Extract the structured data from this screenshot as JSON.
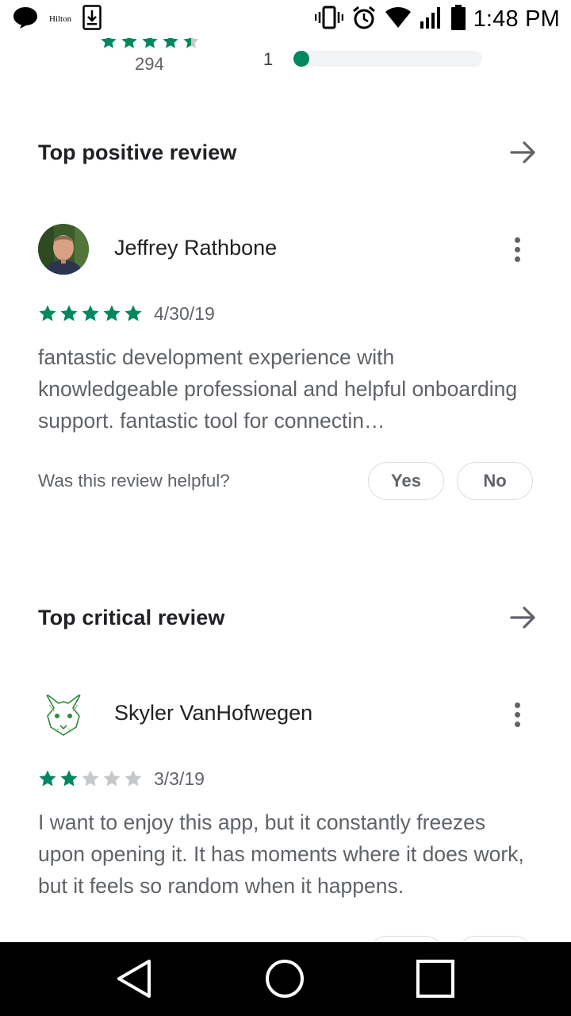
{
  "status_bar": {
    "notification_app_label": "Hilton",
    "time": "1:48 PM",
    "icons": [
      "chat-bubble-icon",
      "download-icon",
      "vibrate-icon",
      "alarm-icon",
      "wifi-icon",
      "signal-icon",
      "battery-icon"
    ]
  },
  "rating_summary": {
    "average_stars": 4.5,
    "review_count": "294",
    "histogram_row_label": "1",
    "histogram_row_fraction": 0.05
  },
  "top_positive": {
    "title": "Top positive review",
    "author": "Jeffrey Rathbone",
    "stars": 5,
    "date": "4/30/19",
    "text": "fantastic development experience with knowledgeable professional and helpful onboarding support. fantastic tool for connectin…",
    "helpful_question": "Was this review helpful?",
    "yes_label": "Yes",
    "no_label": "No"
  },
  "top_critical": {
    "title": "Top critical review",
    "author": "Skyler VanHofwegen",
    "stars": 2,
    "date": "3/3/19",
    "text": "I want to enjoy this app, but it constantly freezes upon opening it. It has moments where it does work, but it feels so random when it happens."
  },
  "colors": {
    "star_filled": "#01875f",
    "star_empty": "#c5c8cb",
    "text_primary": "#202124",
    "text_secondary": "#5f6368",
    "nav_background": "#000000"
  },
  "nav": {
    "icons": [
      "back-icon",
      "home-icon",
      "recents-icon"
    ]
  }
}
